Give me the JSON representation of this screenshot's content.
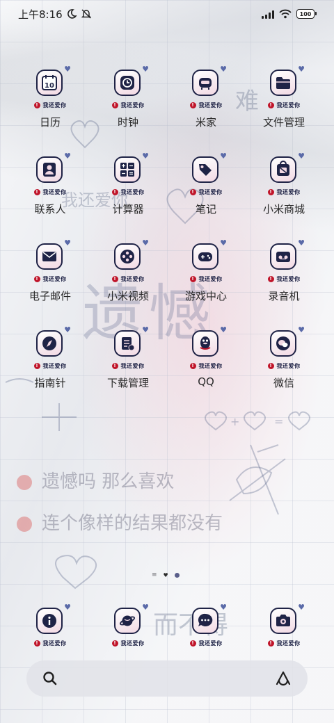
{
  "status_bar": {
    "time": "上午8:16",
    "battery": "100"
  },
  "accent": {
    "icon_border": "#1f2346",
    "alert": "#c0152a",
    "heart": "#5a6aa8"
  },
  "tagline": "我还爱你",
  "apps": [
    {
      "label": "日历",
      "icon": "calendar-icon",
      "icon_text": "10"
    },
    {
      "label": "时钟",
      "icon": "clock-icon"
    },
    {
      "label": "米家",
      "icon": "mijia-icon"
    },
    {
      "label": "文件管理",
      "icon": "folder-icon"
    },
    {
      "label": "联系人",
      "icon": "contacts-icon"
    },
    {
      "label": "计算器",
      "icon": "calculator-icon"
    },
    {
      "label": "笔记",
      "icon": "notes-tag-icon"
    },
    {
      "label": "小米商城",
      "icon": "mi-store-icon"
    },
    {
      "label": "电子邮件",
      "icon": "mail-icon"
    },
    {
      "label": "小米视频",
      "icon": "video-reel-icon"
    },
    {
      "label": "游戏中心",
      "icon": "gamepad-icon"
    },
    {
      "label": "录音机",
      "icon": "recorder-icon"
    },
    {
      "label": "指南针",
      "icon": "compass-icon"
    },
    {
      "label": "下载管理",
      "icon": "download-icon"
    },
    {
      "label": "QQ",
      "icon": "qq-penguin-icon"
    },
    {
      "label": "微信",
      "icon": "wechat-icon"
    }
  ],
  "dock": [
    {
      "icon": "info-icon"
    },
    {
      "icon": "browser-planet-icon"
    },
    {
      "icon": "message-icon"
    },
    {
      "icon": "camera-icon"
    }
  ],
  "wallpaper": {
    "big_text": "遗憾",
    "line1": "遗憾吗 那么喜欢",
    "line2": "连个像样的结果都没有",
    "corner1": "难",
    "corner2": "我还爱你",
    "corner3": "而不得"
  }
}
